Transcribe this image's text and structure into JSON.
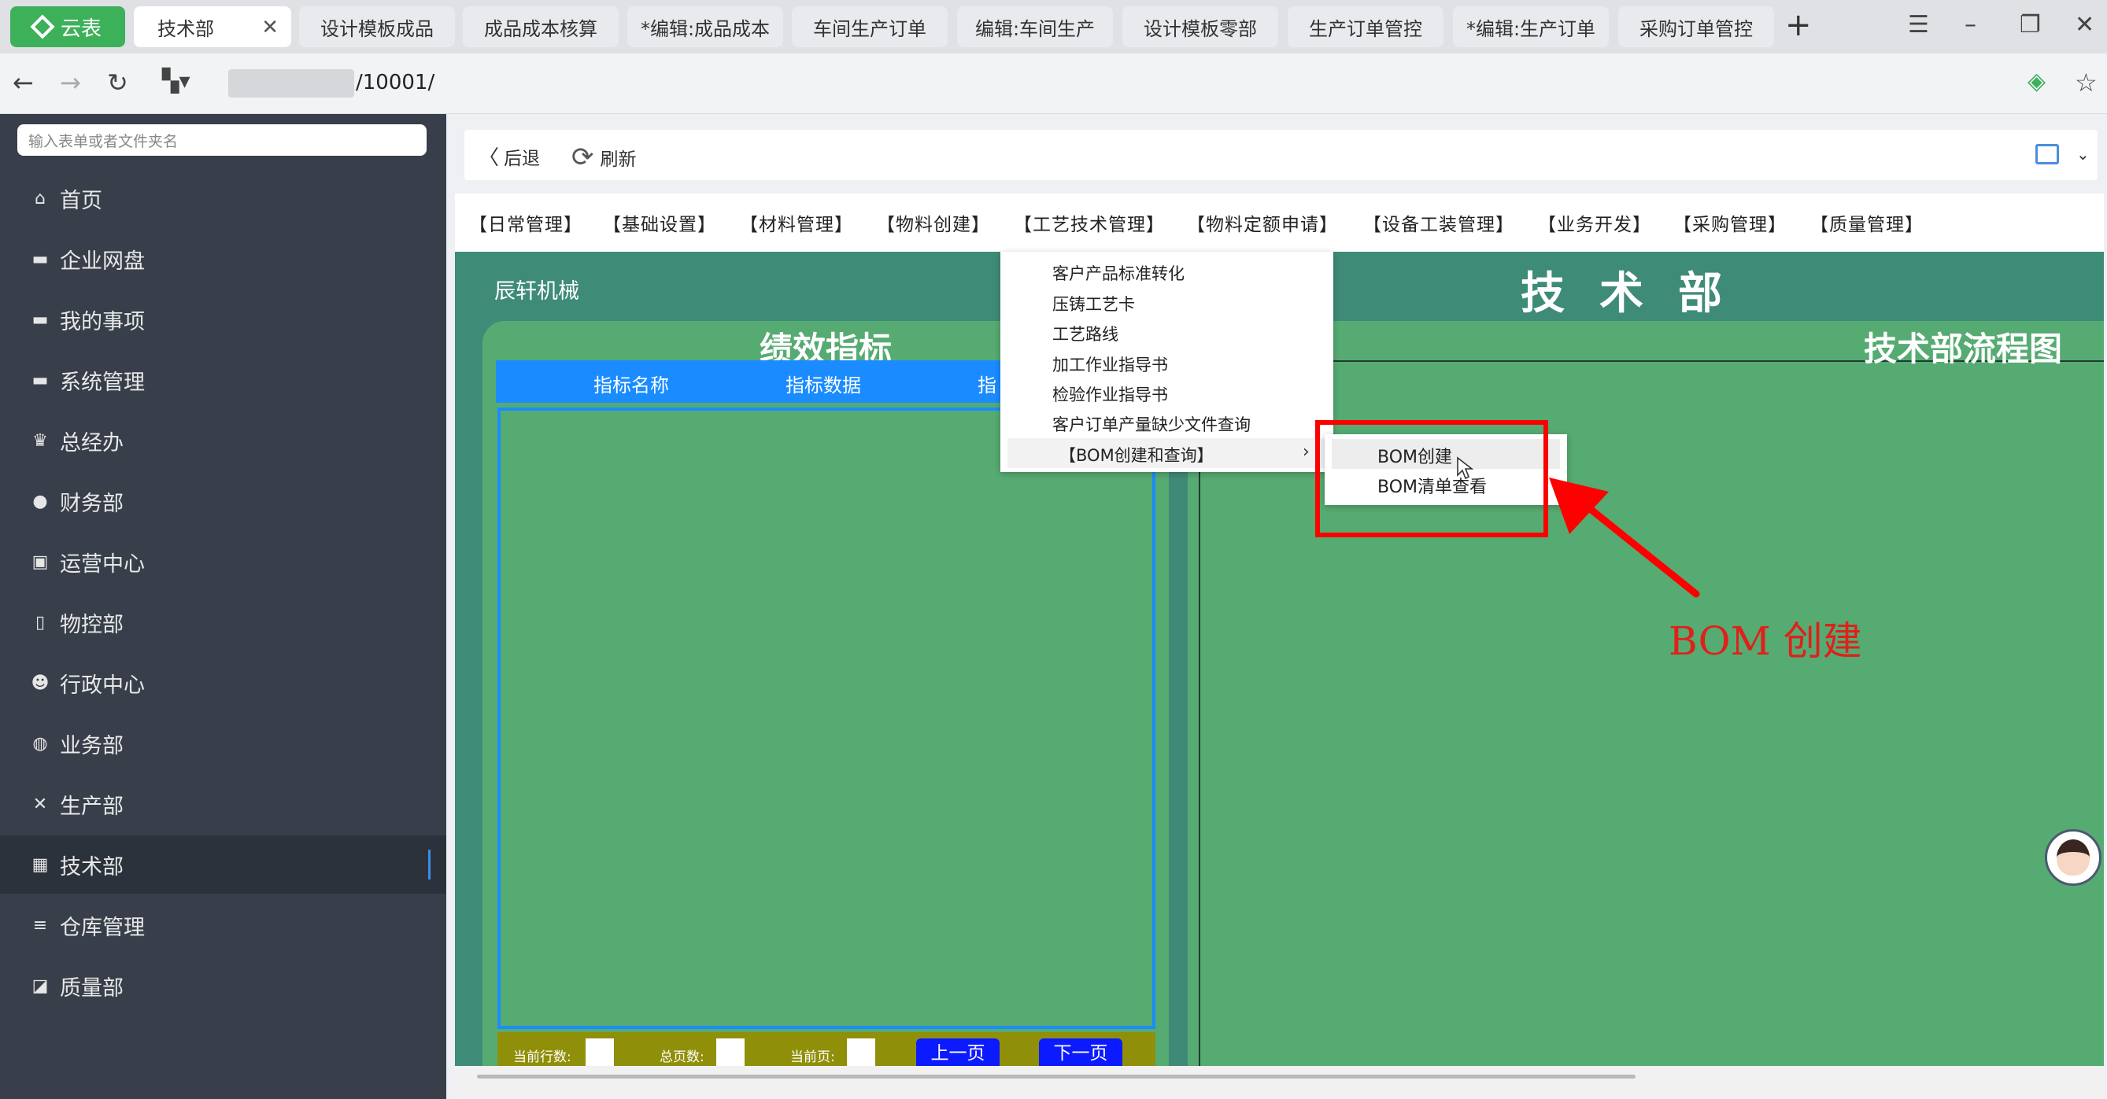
{
  "browser": {
    "brand_label": "云表",
    "tabs": [
      {
        "label": "技术部",
        "active": true
      },
      {
        "label": "设计模板成品"
      },
      {
        "label": "成品成本核算"
      },
      {
        "label": "*编辑:成品成本"
      },
      {
        "label": "车间生产订单"
      },
      {
        "label": "编辑:车间生产"
      },
      {
        "label": "设计模板零部"
      },
      {
        "label": "生产订单管控"
      },
      {
        "label": "*编辑:生产订单"
      },
      {
        "label": "采购订单管控"
      }
    ],
    "close_glyph": "✕",
    "new_tab_glyph": "+",
    "address": "/10001/",
    "icons": [
      "back-arrow-icon",
      "forward-arrow-icon",
      "reload-icon",
      "apps-icon",
      "menu-icon",
      "minimize-icon",
      "restore-icon",
      "close-icon",
      "extension-icon",
      "star-icon"
    ]
  },
  "sidebar": {
    "search_placeholder": "输入表单或者文件夹名",
    "items": [
      {
        "label": "首页",
        "icon": "home-icon",
        "glyph": "⌂"
      },
      {
        "label": "企业网盘",
        "icon": "folder-icon",
        "glyph": "▬"
      },
      {
        "label": "我的事项",
        "icon": "folder-icon",
        "glyph": "▬"
      },
      {
        "label": "系统管理",
        "icon": "folder-icon",
        "glyph": "▬"
      },
      {
        "label": "总经办",
        "icon": "crown-icon",
        "glyph": "♛"
      },
      {
        "label": "财务部",
        "icon": "money-bag-icon",
        "glyph": "●"
      },
      {
        "label": "运营中心",
        "icon": "briefcase-icon",
        "glyph": "▣"
      },
      {
        "label": "物控部",
        "icon": "phone-icon",
        "glyph": "▯"
      },
      {
        "label": "行政中心",
        "icon": "user-icon",
        "glyph": "☻"
      },
      {
        "label": "业务部",
        "icon": "globe-icon",
        "glyph": "◍"
      },
      {
        "label": "生产部",
        "icon": "tools-icon",
        "glyph": "✕"
      },
      {
        "label": "技术部",
        "icon": "grid-icon",
        "glyph": "▦",
        "active": true
      },
      {
        "label": "仓库管理",
        "icon": "database-icon",
        "glyph": "≡"
      },
      {
        "label": "质量部",
        "icon": "chart-icon",
        "glyph": "◪"
      }
    ]
  },
  "toolbar": {
    "back_label": "后退",
    "refresh_label": "刷新",
    "back_glyph": "〈",
    "refresh_glyph": "⟳"
  },
  "menubar": {
    "items": [
      "【日常管理】",
      "【基础设置】",
      "【材料管理】",
      "【物料创建】",
      "【工艺技术管理】",
      "【物料定额申请】",
      "【设备工装管理】",
      "【业务开发】",
      "【采购管理】",
      "【质量管理】"
    ]
  },
  "dashboard": {
    "company": "辰轩机械",
    "department_title": "技术部",
    "perf_title": "绩效指标",
    "perf_columns": [
      "指标名称",
      "指标数据",
      "指"
    ],
    "pager": {
      "rows_label": "当前行数:",
      "pages_label": "总页数:",
      "current_label": "当前页:",
      "prev_label": "上一页",
      "next_label": "下一页"
    },
    "flow_title": "技术部流程图"
  },
  "dropdown": {
    "items": [
      "客户产品标准转化",
      "压铸工艺卡",
      "工艺路线",
      "加工作业指导书",
      "检验作业指导书",
      "客户订单产量缺少文件查询"
    ],
    "submenu_parent": "【BOM创建和查询】",
    "arrow_glyph": "›",
    "submenu": [
      "BOM创建",
      "BOM清单查看"
    ]
  },
  "annotation": {
    "text": "BOM 创建",
    "color": "#e0201a"
  },
  "colors": {
    "brand_green": "#3db15a",
    "sidebar_bg": "#383f4a",
    "dashboard_teal": "#3e8b78",
    "panel_green": "#56ab72",
    "header_blue": "#1a8cff",
    "pager_olive": "#8f8f0a",
    "button_blue": "#0c1aff",
    "annotation_red": "#ff0000"
  }
}
